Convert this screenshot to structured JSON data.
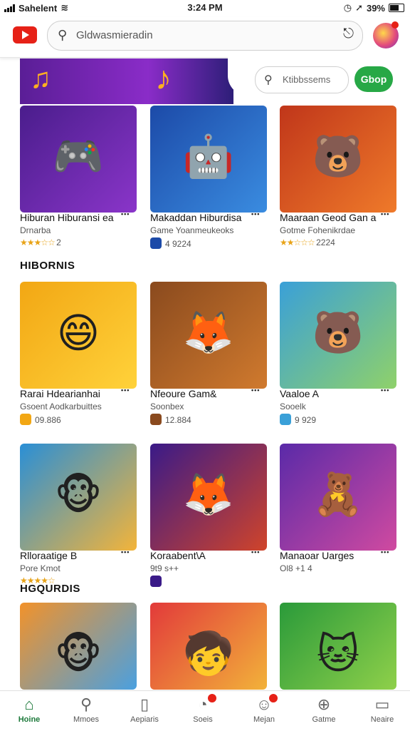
{
  "status_bar": {
    "carrier": "Sahelent",
    "time": "3:24 PM",
    "battery": "39%"
  },
  "header": {
    "search_text": "Gldwasmieradin"
  },
  "hero": {
    "search_text": "Ktibbssems",
    "shop_label": "Gbop"
  },
  "sections": [
    {
      "heading": "HIBORNIS"
    },
    {
      "heading": "HGQURDIS"
    }
  ],
  "rows": [
    [
      {
        "title": "Hiburan Hiburansi ea",
        "subtitle": "Drnarba",
        "meta": "2",
        "meta_kind": "stars",
        "rating": 2.5,
        "art": "game-controller",
        "colors": [
          "#4a1d8c",
          "#8a35c9"
        ],
        "icon": "controller-icon"
      },
      {
        "title": "Makaddan Hiburdisa",
        "subtitle": "Game Yoanmeukeoks",
        "meta": "4 9224",
        "meta_kind": "icon",
        "art": "puzzle-bot",
        "colors": [
          "#1c4aa8",
          "#3a8ce0"
        ],
        "icon": "robot-icon"
      },
      {
        "title": "Maaraan Geod Gan a",
        "subtitle": "Gotme Fohenikrdae",
        "meta": "2224",
        "meta_kind": "stars",
        "rating": 2,
        "art": "bear-gamer",
        "colors": [
          "#c0361a",
          "#ef7a2a"
        ],
        "icon": "bear-icon"
      }
    ],
    [
      {
        "title": "Rarai Hdearianhai",
        "subtitle": "Gsoent Aodkarbuittes",
        "meta": "09.886",
        "meta_kind": "icon",
        "art": "happy-blob",
        "colors": [
          "#f2a714",
          "#ffd23a"
        ],
        "icon": "blob-icon"
      },
      {
        "title": "Nfeoure Gam&",
        "subtitle": "Soonbex",
        "meta": "12.884",
        "meta_kind": "icon",
        "art": "fox-runner",
        "colors": [
          "#8a4a1e",
          "#d07a2e"
        ],
        "icon": "fox-icon"
      },
      {
        "title": "Vaaloe  A",
        "subtitle": "Sooelk",
        "meta": "9 929",
        "meta_kind": "icon",
        "art": "heark-hondes",
        "colors": [
          "#3aa0d8",
          "#8fd16a"
        ],
        "icon": "bear-icon"
      }
    ],
    [
      {
        "title": "Rlloraatige B",
        "subtitle": "Pore Kmot",
        "meta": "",
        "meta_kind": "stars",
        "rating": 3.5,
        "art": "ponsk-hiardias",
        "colors": [
          "#2a8fd6",
          "#f3b43a"
        ],
        "icon": "monkey-icon"
      },
      {
        "title": "Koraabent\\A",
        "subtitle": "9t9 s++",
        "meta": "",
        "meta_kind": "icon",
        "art": "jimbh-helitans",
        "colors": [
          "#3a1a88",
          "#d0442a"
        ],
        "icon": "fox-icon"
      },
      {
        "title": "Manaoar Uarges",
        "subtitle": "Ol8 +1 4",
        "meta": "",
        "meta_kind": "none",
        "art": "aucorlbs",
        "colors": [
          "#5a2aa8",
          "#d04aa0"
        ],
        "icon": "block-icon"
      }
    ],
    [
      {
        "title": "",
        "subtitle": "",
        "meta": "",
        "meta_kind": "none",
        "art": "monkey-gamer",
        "colors": [
          "#f2922a",
          "#4aa0e0"
        ],
        "icon": "monkey-icon"
      },
      {
        "title": "",
        "subtitle": "",
        "meta": "",
        "meta_kind": "none",
        "art": "wild-kid",
        "colors": [
          "#e23a3a",
          "#f2b23a"
        ],
        "icon": "kid-icon"
      },
      {
        "title": "",
        "subtitle": "",
        "meta": "",
        "meta_kind": "none",
        "art": "orange-cat",
        "colors": [
          "#2a9a3a",
          "#8fd04a"
        ],
        "icon": "cat-icon"
      }
    ]
  ],
  "nav": [
    {
      "label": "Hoine",
      "icon": "home-icon",
      "active": true
    },
    {
      "label": "Mmoes",
      "icon": "search-icon",
      "active": false
    },
    {
      "label": "Aepiaris",
      "icon": "phone-icon",
      "active": false
    },
    {
      "label": "Soeis",
      "icon": "chat-icon",
      "active": false,
      "badge": true
    },
    {
      "label": "Mejan",
      "icon": "profile-icon",
      "active": false,
      "badge": true
    },
    {
      "label": "Gatme",
      "icon": "game-icon",
      "active": false
    },
    {
      "label": "Neaire",
      "icon": "library-icon",
      "active": false
    }
  ]
}
